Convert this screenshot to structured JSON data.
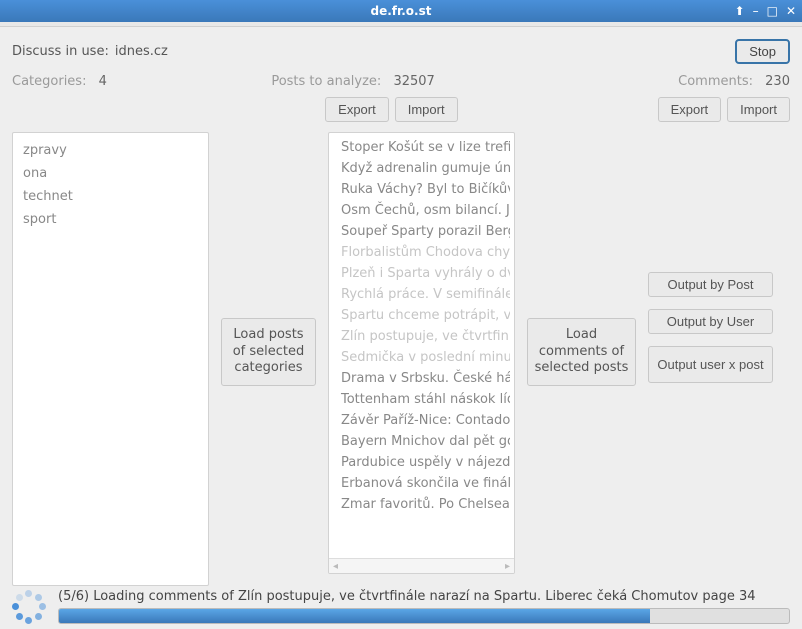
{
  "window": {
    "title": "de.fr.o.st",
    "stop_label": "Stop"
  },
  "top": {
    "discuss_label": "Discuss in use:",
    "discuss_value": "idnes.cz"
  },
  "stats": {
    "categories_label": "Categories:",
    "categories_value": "4",
    "posts_label": "Posts to analyze:",
    "posts_value": "32507",
    "comments_label": "Comments:",
    "comments_value": "230"
  },
  "buttons": {
    "export": "Export",
    "import": "Import",
    "load_posts": "Load posts of selected categories",
    "load_comments": "Load comments of selected posts",
    "output_by_post": "Output by Post",
    "output_by_user": "Output by User",
    "output_user_x_post": "Output user x post"
  },
  "categories": [
    "zpravy",
    "ona",
    "technet",
    "sport"
  ],
  "posts": [
    {
      "t": "Stoper Košút se v lize trefi",
      "d": false
    },
    {
      "t": "Když adrenalin gumuje úna",
      "d": false
    },
    {
      "t": "Ruka Váchy? Byl to Bičíkův",
      "d": false
    },
    {
      "t": "Osm Čechů, osm bilancí. Ja",
      "d": false
    },
    {
      "t": "Soupeř Sparty porazil Berg",
      "d": false
    },
    {
      "t": "Florbalistům Chodova chyb",
      "d": true
    },
    {
      "t": "Plzeň i Sparta vyhrály o dv",
      "d": true
    },
    {
      "t": "Rychlá práce. V semifinále",
      "d": true
    },
    {
      "t": "Spartu chceme potrápit, va",
      "d": true
    },
    {
      "t": "Zlín postupuje, ve čtvrtfin",
      "d": true
    },
    {
      "t": "Sedmička v poslední minu",
      "d": true
    },
    {
      "t": "Drama v Srbsku. České há",
      "d": false
    },
    {
      "t": "Tottenham stáhl náskok líd",
      "d": false
    },
    {
      "t": "Závěr Paříž-Nice: Contador",
      "d": false
    },
    {
      "t": "Bayern Mnichov dal pět gó",
      "d": false
    },
    {
      "t": "Pardubice uspěly v nájezd",
      "d": false
    },
    {
      "t": "Erbanová skončila ve finál",
      "d": false
    },
    {
      "t": "Zmar favoritů. Po Chelsea",
      "d": false
    }
  ],
  "status": {
    "message": "(5/6) Loading comments of Zlín postupuje, ve čtvrtfinále narazí na Spartu. Liberec čeká Chomutov page 34",
    "progress_percent": 81
  }
}
